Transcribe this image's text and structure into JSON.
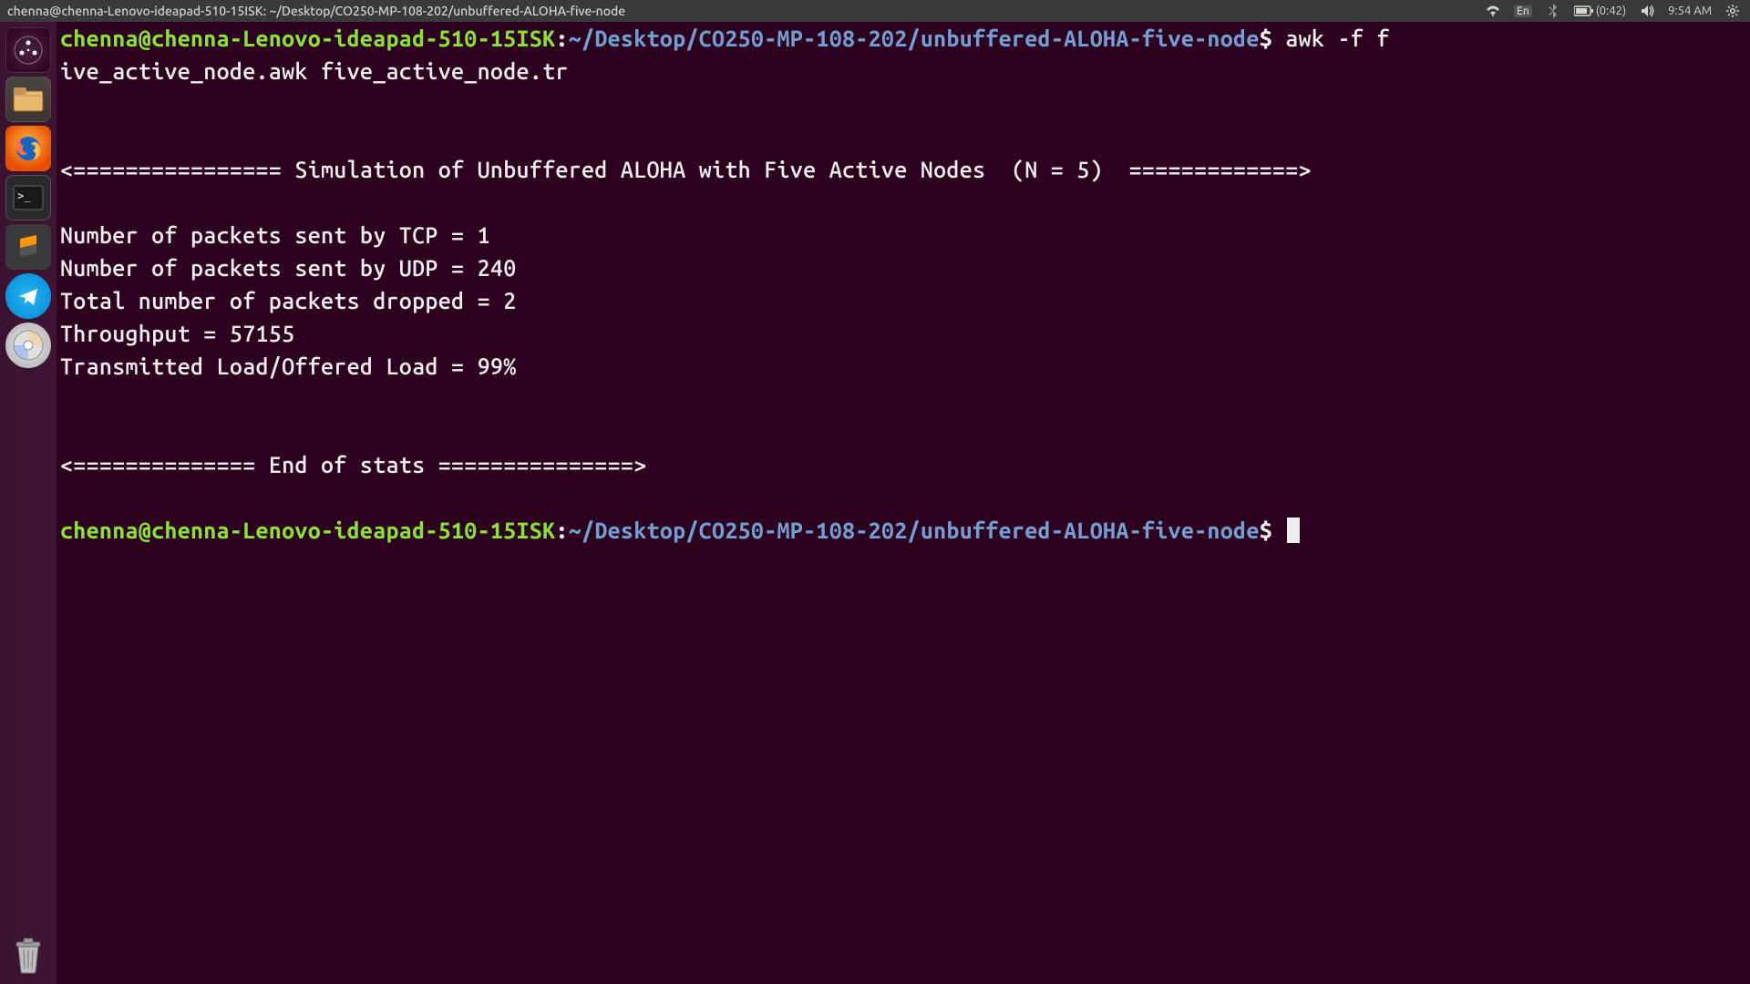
{
  "top_panel": {
    "window_title": "chenna@chenna-Lenovo-ideapad-510-15ISK: ~/Desktop/CO250-MP-108-202/unbuffered-ALOHA-five-node",
    "lang": "En",
    "battery": "(0:42)",
    "time": "9:54 AM"
  },
  "launcher": {
    "items": [
      {
        "name": "dash",
        "label": "Search"
      },
      {
        "name": "files",
        "label": "Files"
      },
      {
        "name": "firefox",
        "label": "Firefox"
      },
      {
        "name": "terminal",
        "label": "Terminal"
      },
      {
        "name": "sublime",
        "label": "Sublime Text"
      },
      {
        "name": "telegram",
        "label": "Telegram"
      },
      {
        "name": "disk",
        "label": "Disk"
      }
    ],
    "trash": "Trash"
  },
  "terminal": {
    "prompt_user_host": "chenna@chenna-Lenovo-ideapad-510-15ISK",
    "prompt_colon": ":",
    "prompt_path": "~/Desktop/CO250-MP-108-202/unbuffered-ALOHA-five-node",
    "prompt_dollar": "$",
    "cmd_line1": " awk -f f",
    "cmd_line2": "ive_active_node.awk five_active_node.tr",
    "blank": "",
    "out_header": "<================ Simulation of Unbuffered ALOHA with Five Active Nodes  (N = 5)  =============>",
    "out_tcp": "Number of packets sent by TCP = 1",
    "out_udp": "Number of packets sent by UDP = 240",
    "out_drop": "Total number of packets dropped = 2",
    "out_thr": "Throughput = 57155",
    "out_ratio": "Transmitted Load/Offered Load = 99%",
    "out_end": "<============== End of stats ===============>"
  }
}
